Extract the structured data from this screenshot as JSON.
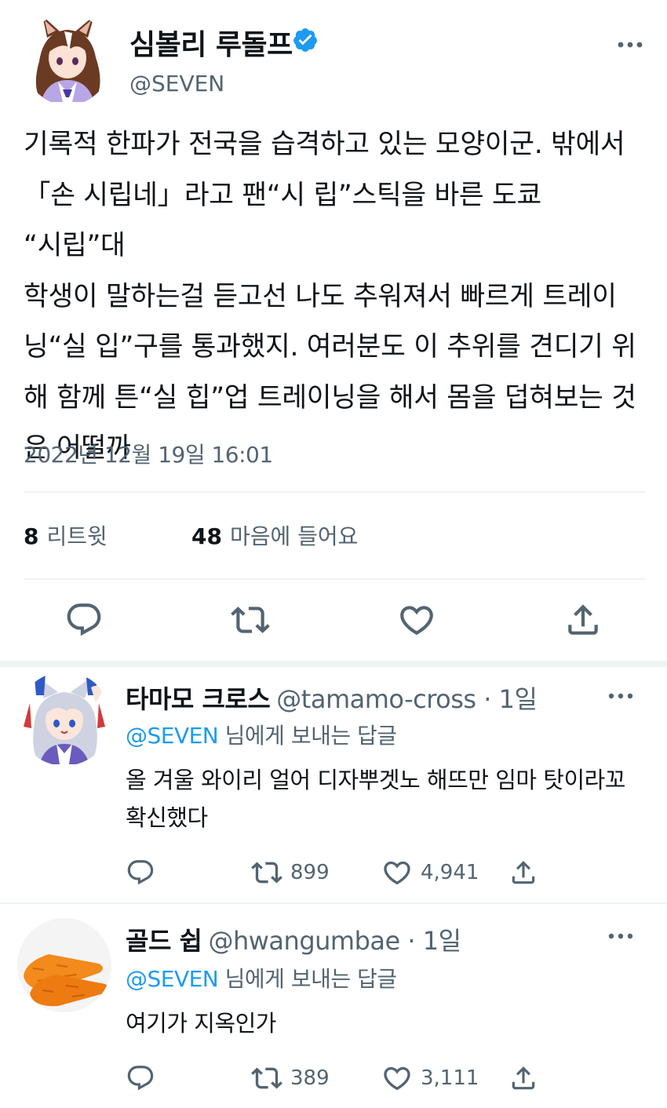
{
  "main_tweet": {
    "author_name": "심볼리 루돌프",
    "author_handle": "@SEVEN",
    "avatar_icon": "anime-horse-girl-avatar-icon",
    "verified_icon": "verified-badge-icon",
    "verified_color": "#1d9bf0",
    "text_lines": [
      "기록적 한파가 전국을 습격하고 있는 모양이군. 밖에서",
      "「손 시립네」라고 팬“시 립”스틱을 바른 도쿄 “시립”대",
      "학생이 말하는걸 듣고선 나도 추워져서 빠르게 트레이",
      "닝“실 입”구를 통과했지. 여러분도 이 추위를 견디기 위",
      "해 함께 튼“실 힙”업 트레이닝을 해서 몸을 덥혀보는 것",
      "은 어떨까"
    ],
    "timestamp": "2022년 12월 19일 16:01",
    "retweet_count": "8",
    "retweet_label": "리트윗",
    "like_count": "48",
    "like_label": "마음에 들어요",
    "actions": [
      "reply-icon",
      "retweet-icon",
      "like-icon",
      "share-icon"
    ]
  },
  "replies": [
    {
      "author_name": "타마모 크로스",
      "author_handle": "@tamamo-cross · 1일",
      "avatar_icon": "anime-silver-hair-avatar-icon",
      "reply_to_mention": "@SEVEN",
      "reply_to_suffix": " 님에게 보내는 답글",
      "text": "올 겨울 와이리 얼어 디자뿌겟노 해뜨만 임마 탓이라꼬 확신했다",
      "retweets": "899",
      "likes": "4,941"
    },
    {
      "author_name": "골드 쉽",
      "author_handle": "@hwangumbae · 1일",
      "avatar_icon": "carrot-avatar-icon",
      "reply_to_mention": "@SEVEN",
      "reply_to_suffix": " 님에게 보내는 답글",
      "text": "여기가 지옥인가",
      "retweets": "389",
      "likes": "3,111"
    }
  ],
  "colors": {
    "text_primary": "#0f1419",
    "text_secondary": "#536471",
    "accent": "#1d9bf0",
    "divider": "#eff3f4"
  }
}
